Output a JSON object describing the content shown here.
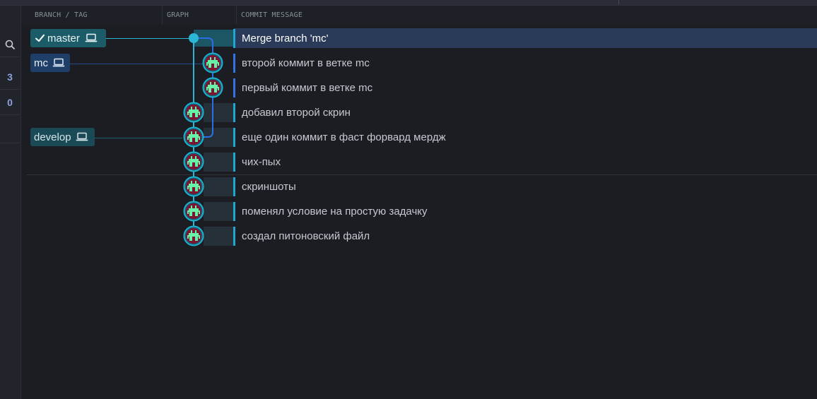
{
  "header": {
    "branch_tag": "BRANCH / TAG",
    "graph": "GRAPH",
    "commit_message": "COMMIT MESSAGE"
  },
  "left_panel": {
    "count_1": "3",
    "count_2": "0",
    "search_icon": "search-icon"
  },
  "branches": [
    {
      "name": "master",
      "checked": true,
      "icon": "laptop-icon",
      "color": "#1b5c68"
    },
    {
      "name": "mc",
      "checked": false,
      "icon": "laptop-icon",
      "color": "#1f3e68"
    },
    {
      "name": "develop",
      "checked": false,
      "icon": "laptop-icon",
      "color": "#194a56"
    }
  ],
  "commits": [
    {
      "message": "Merge branch 'mc'",
      "selected": true,
      "lane": "master",
      "node": "merge-node"
    },
    {
      "message": "второй коммит в ветке mc",
      "selected": false,
      "lane": "mc",
      "node": "avatar-icon"
    },
    {
      "message": "первый коммит в ветке mc",
      "selected": false,
      "lane": "mc",
      "node": "avatar-icon"
    },
    {
      "message": "добавил второй скрин",
      "selected": false,
      "lane": "master",
      "node": "avatar-icon"
    },
    {
      "message": "еще один коммит в фаст форвард мердж",
      "selected": false,
      "lane": "master",
      "node": "avatar-icon"
    },
    {
      "message": "чих-пых",
      "selected": false,
      "lane": "master",
      "node": "avatar-icon"
    },
    {
      "message": "скриншоты",
      "selected": false,
      "lane": "master",
      "node": "avatar-icon"
    },
    {
      "message": "поменял условие на простую задачку",
      "selected": false,
      "lane": "master",
      "node": "avatar-icon"
    },
    {
      "message": "создал питоновский файл",
      "selected": false,
      "lane": "master",
      "node": "avatar-icon"
    }
  ],
  "colors": {
    "master_lane": "#2bb6d5",
    "mc_lane": "#2b6ee6",
    "selection": "#293b59",
    "avatar_face": "#66f2a7",
    "avatar_background": "#7a1534"
  }
}
